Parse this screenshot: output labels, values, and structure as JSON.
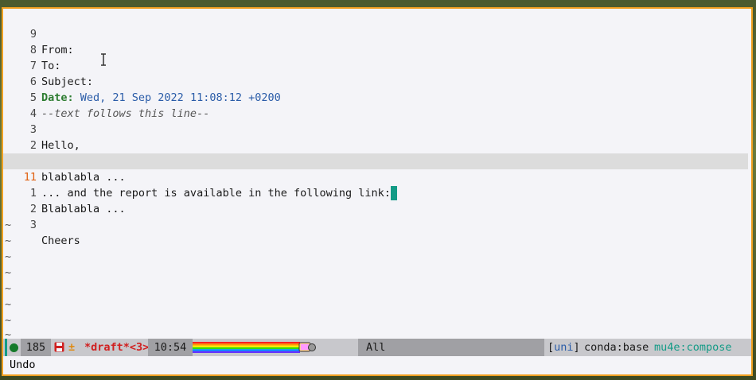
{
  "buffer": {
    "lines": [
      {
        "num": "9",
        "text": "From:"
      },
      {
        "num": "8",
        "text": "To:"
      },
      {
        "num": "7",
        "text": "Subject:"
      },
      {
        "num": "6",
        "label": "Date:",
        "value": " Wed, 21 Sep 2022 11:08:12 +0200"
      },
      {
        "num": "5",
        "text": "--text follows this line--"
      },
      {
        "num": "4",
        "text": ""
      },
      {
        "num": "3",
        "text": "Hello,"
      },
      {
        "num": "2",
        "text": ""
      },
      {
        "num": "1",
        "text": "blablabla ..."
      },
      {
        "num": "11",
        "text": "... and the report is available in the following link:"
      },
      {
        "num": "1",
        "text": "Blablabla ..."
      },
      {
        "num": "2",
        "text": ""
      },
      {
        "num": "3",
        "text": "Cheers"
      }
    ],
    "empty_marker": "~"
  },
  "modeline": {
    "line_count": "185",
    "narrow_symbol": "±",
    "buffer_name": "*draft*<3>",
    "time": "10:54",
    "position": "All",
    "encoding_open": "[",
    "encoding": "uni",
    "encoding_close": "]",
    "conda": "conda:base",
    "major_mode": "mu4e:compose"
  },
  "echo_area": {
    "message": "Undo"
  },
  "colors": {
    "frame_border": "#f0a020",
    "cursor": "#139b86",
    "current_line": "#dcdcdc",
    "modified_buffer": "#d02020"
  }
}
